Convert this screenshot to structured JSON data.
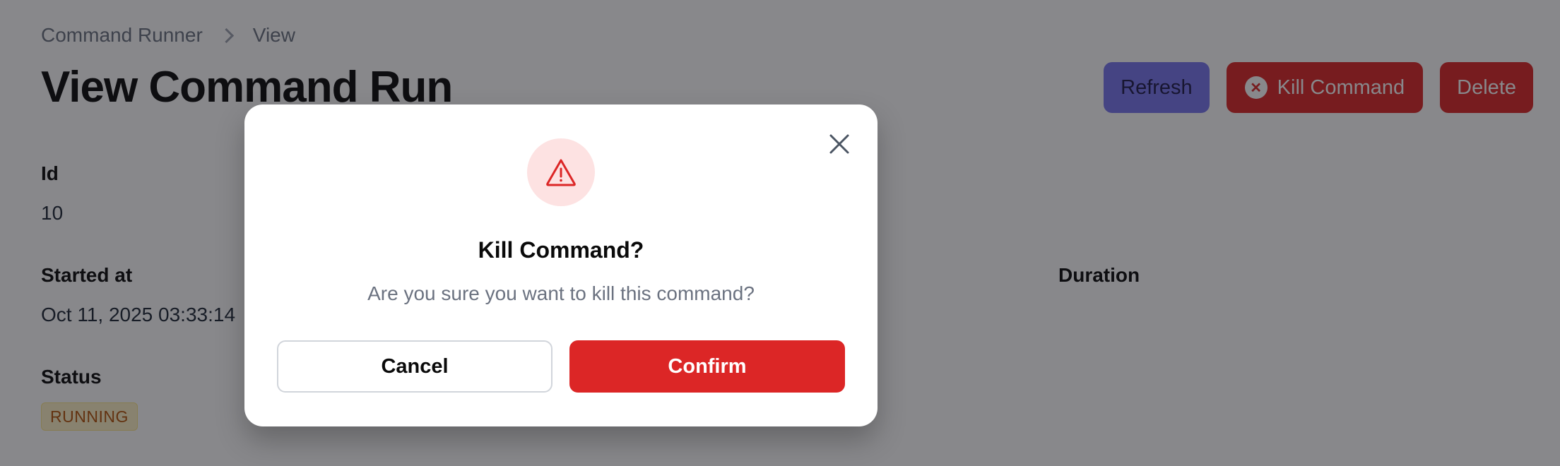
{
  "breadcrumb": {
    "items": [
      "Command Runner",
      "View"
    ]
  },
  "page": {
    "title": "View Command Run"
  },
  "header_actions": {
    "refresh_label": "Refresh",
    "kill_label": "Kill Command",
    "delete_label": "Delete"
  },
  "fields": {
    "id_label": "Id",
    "id_value": "10",
    "started_label": "Started at",
    "started_value": "Oct 11, 2025 03:33:14",
    "duration_label": "Duration",
    "status_label": "Status",
    "status_value": "RUNNING"
  },
  "modal": {
    "title": "Kill Command?",
    "message": "Are you sure you want to kill this command?",
    "cancel_label": "Cancel",
    "confirm_label": "Confirm",
    "icon": "warning-triangle-icon"
  },
  "colors": {
    "danger": "#dc2626",
    "primary": "#7877ee",
    "badge_bg": "#fef3c7",
    "badge_text": "#b45309"
  }
}
